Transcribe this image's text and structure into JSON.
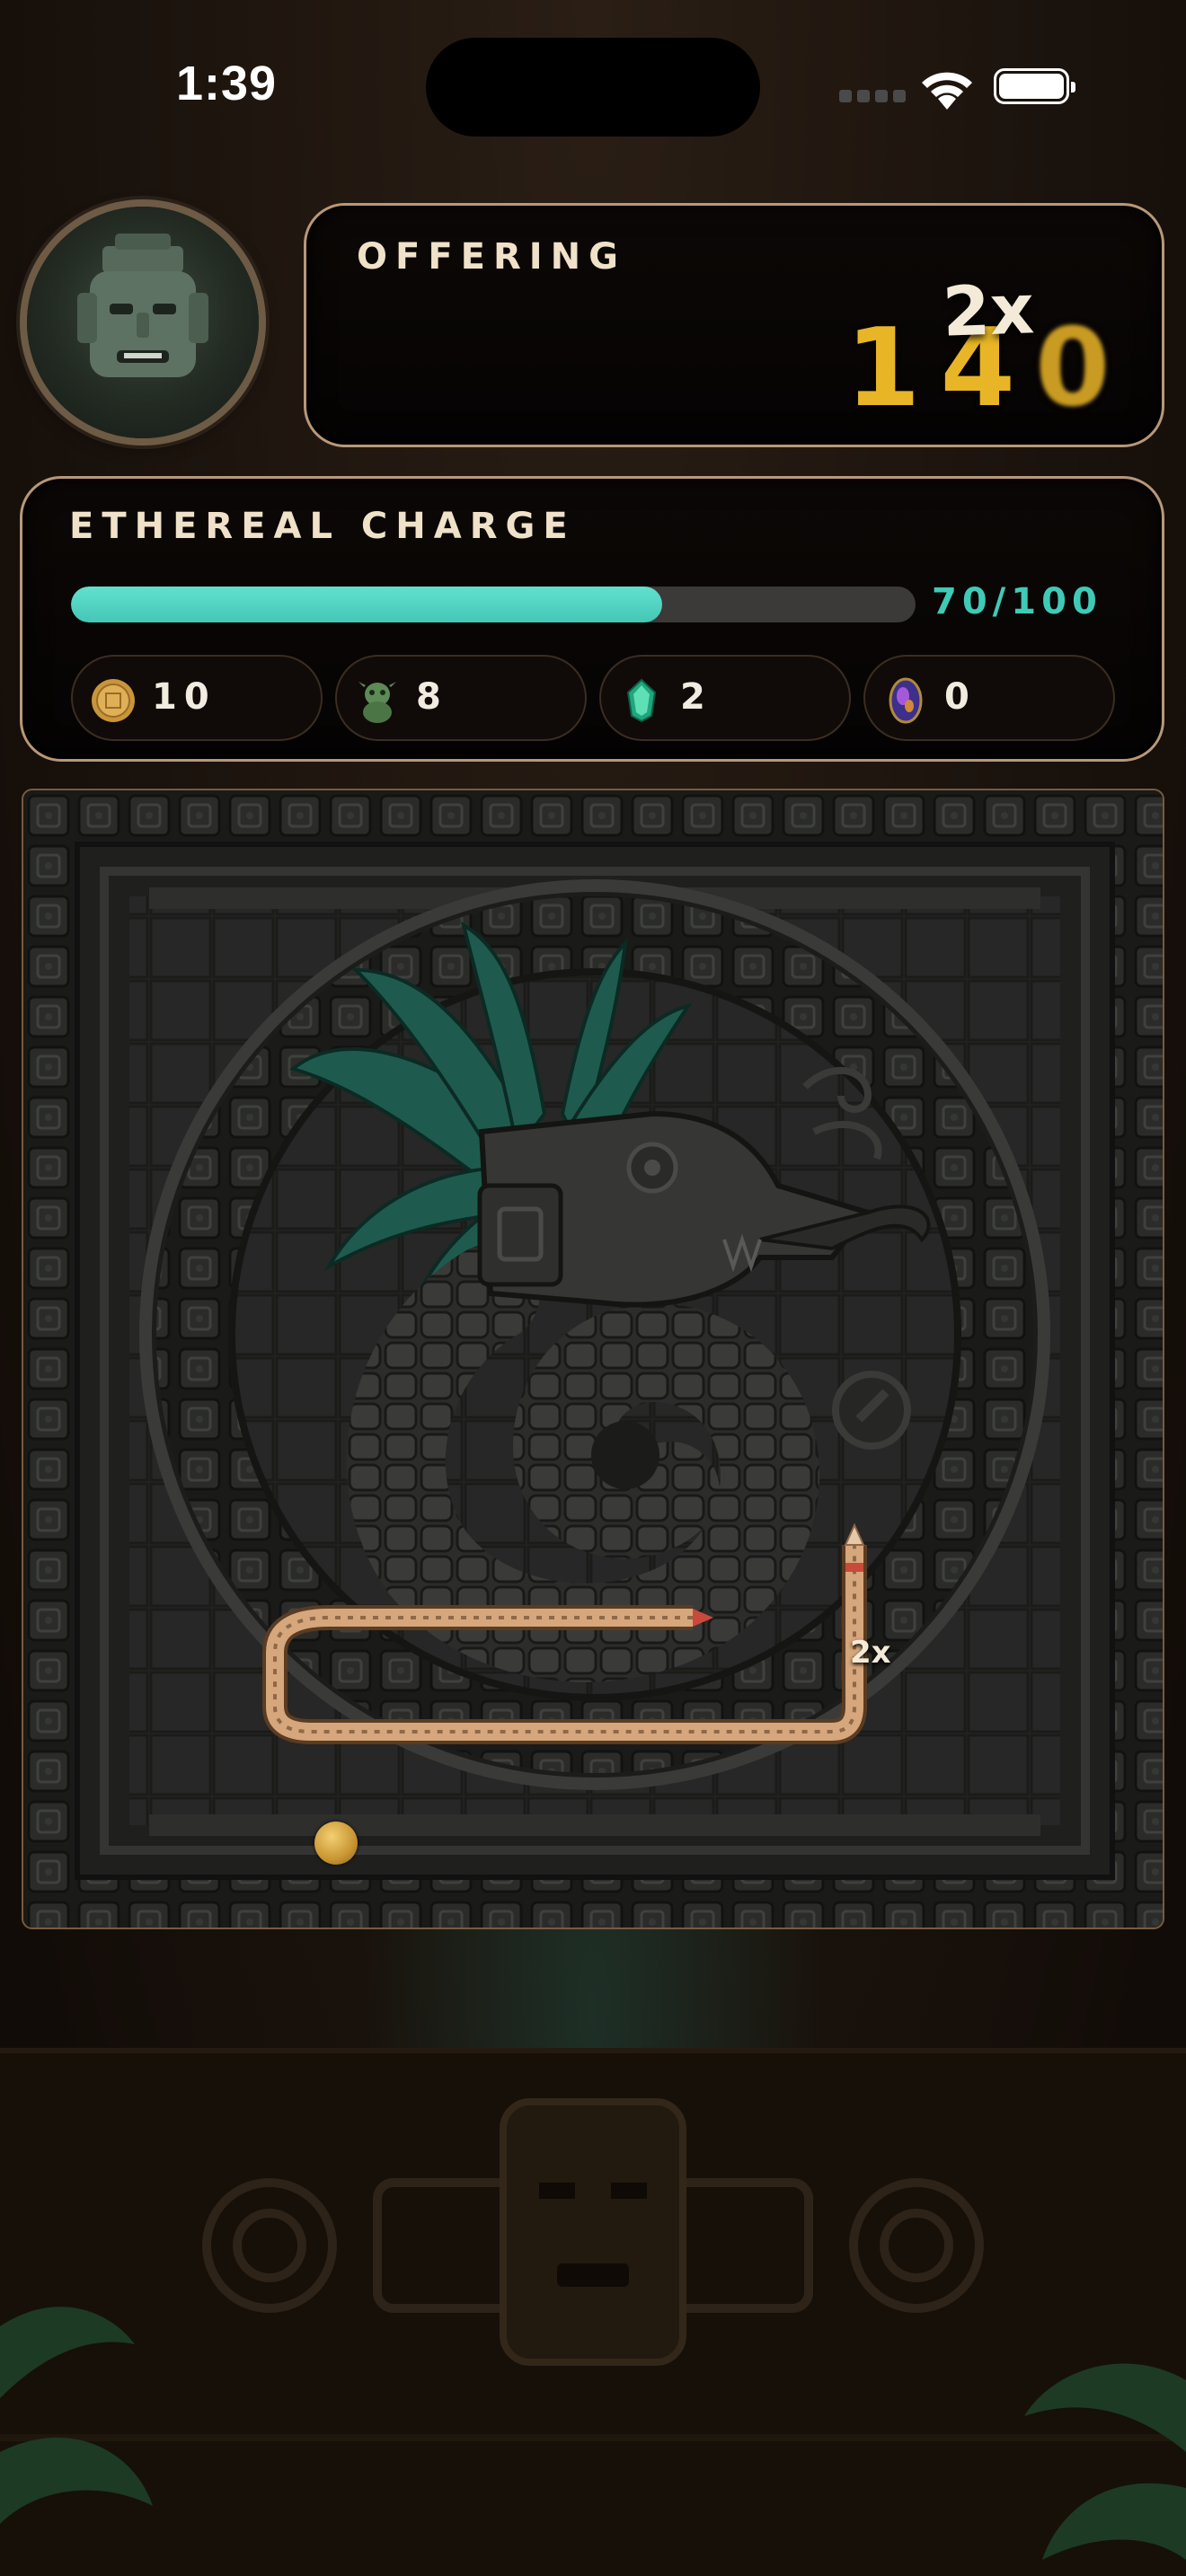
{
  "status_bar": {
    "time": "1:39"
  },
  "offering": {
    "title": "OFFERING",
    "multiplier": "2x",
    "score": [
      "1",
      "4",
      "0"
    ]
  },
  "ethereal_charge": {
    "title": "ETHEREAL CHARGE",
    "current": 70,
    "max": 100,
    "display": "70/100",
    "fill_fraction": 0.7
  },
  "resources": [
    {
      "icon": "gold-coin-icon",
      "count": "10"
    },
    {
      "icon": "jade-idol-icon",
      "count": "8"
    },
    {
      "icon": "emerald-gem-icon",
      "count": "2"
    },
    {
      "icon": "opal-gem-icon",
      "count": "0"
    }
  ],
  "board": {
    "snake_multiplier": "2x"
  },
  "colors": {
    "accent_teal": "#45c7b6",
    "gold": "#e8b526",
    "panel_border": "#b89878"
  }
}
